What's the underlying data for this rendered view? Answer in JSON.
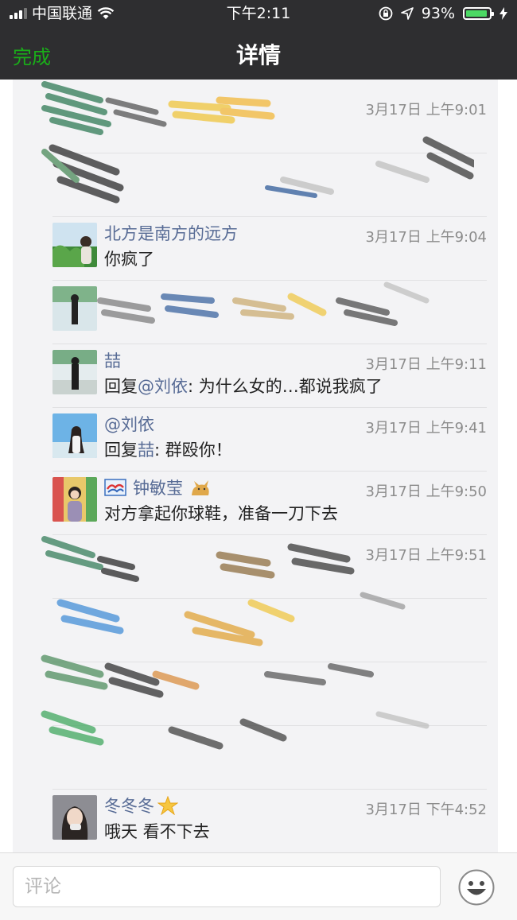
{
  "status_bar": {
    "carrier": "中国联通",
    "time": "下午2:11",
    "battery_percent": "93%",
    "battery_level": 0.93
  },
  "nav": {
    "done_label": "完成",
    "title": "详情"
  },
  "comments": [
    {
      "name": "",
      "time": "3月17日 上午9:01",
      "text": "",
      "redacted": true
    },
    {
      "name": "",
      "time": "",
      "text": "",
      "redacted": true
    },
    {
      "name": "北方是南方的远方",
      "time": "3月17日 上午9:04",
      "text": "你疯了"
    },
    {
      "name": "",
      "time": "",
      "text": "",
      "redacted": true
    },
    {
      "name": "喆",
      "time": "3月17日 上午9:11",
      "text_prefix": "回复",
      "text_ref": "@刘依",
      "text_body": ": 为什么女的…都说我疯了"
    },
    {
      "name": "@刘依",
      "time": "3月17日 上午9:41",
      "text_prefix": "回复",
      "text_ref": "喆",
      "text_body": ": 群殴你！"
    },
    {
      "name": "钟敏莹",
      "time": "3月17日 上午9:50",
      "text": "对方拿起你球鞋，准备一刀下去",
      "name_icon_left": "kite-icon",
      "name_icon_right": "cat-icon"
    },
    {
      "name": "",
      "time": "3月17日 上午9:51",
      "text": "",
      "redacted": true
    },
    {
      "name": "",
      "time": "",
      "text": "",
      "redacted": true
    },
    {
      "name": "",
      "time": "",
      "text": "",
      "redacted": true
    },
    {
      "name": "",
      "time": "",
      "text": "",
      "redacted": true
    },
    {
      "name": "冬冬冬",
      "time": "3月17日 下午4:52",
      "text": "哦天 看不下去",
      "name_icon_right": "star-icon"
    }
  ],
  "input": {
    "placeholder": "评论"
  },
  "colors": {
    "nav_background": "#2e2e30",
    "accent_green": "#1aad19",
    "name_blue": "#576b95",
    "panel_background": "#f3f3f5"
  }
}
